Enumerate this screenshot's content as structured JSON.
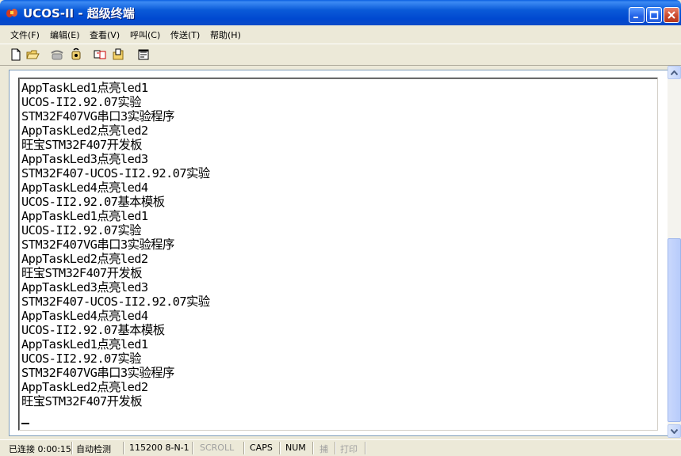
{
  "window": {
    "title": "UCOS-II - 超级终端",
    "app_icon": "hyperterminal-icon",
    "controls": [
      "minimize-icon",
      "maximize-icon",
      "close-icon"
    ]
  },
  "menu": [
    {
      "label": "文件(F)"
    },
    {
      "label": "编辑(E)"
    },
    {
      "label": "查看(V)"
    },
    {
      "label": "呼叫(C)"
    },
    {
      "label": "传送(T)"
    },
    {
      "label": "帮助(H)"
    }
  ],
  "toolbar": {
    "icons": [
      "new-icon",
      "open-icon",
      "call-icon",
      "disconnect-icon",
      "send-icon",
      "receive-icon",
      "properties-icon"
    ]
  },
  "terminal": {
    "lines": [
      "AppTaskLed1点亮led1",
      "UCOS-II2.92.07实验",
      "STM32F407VG串口3实验程序",
      "AppTaskLed2点亮led2",
      "旺宝STM32F407开发板",
      "AppTaskLed3点亮led3",
      "STM32F407-UCOS-II2.92.07实验",
      "AppTaskLed4点亮led4",
      "UCOS-II2.92.07基本模板",
      "AppTaskLed1点亮led1",
      "UCOS-II2.92.07实验",
      "STM32F407VG串口3实验程序",
      "AppTaskLed2点亮led2",
      "旺宝STM32F407开发板",
      "AppTaskLed3点亮led3",
      "STM32F407-UCOS-II2.92.07实验",
      "AppTaskLed4点亮led4",
      "UCOS-II2.92.07基本模板",
      "AppTaskLed1点亮led1",
      "UCOS-II2.92.07实验",
      "STM32F407VG串口3实验程序",
      "AppTaskLed2点亮led2",
      "旺宝STM32F407开发板"
    ]
  },
  "status": {
    "connection": "已连接 0:00:15",
    "detect": "自动检测",
    "port": "115200 8-N-1",
    "scroll": "SCROLL",
    "caps": "CAPS",
    "num": "NUM",
    "capture": "捕",
    "print": "打印"
  },
  "colors": {
    "titlebar": "#0a5ad8",
    "window_bg": "#ece9d8",
    "terminal_bg": "#ffffff",
    "terminal_text": "#000000"
  }
}
